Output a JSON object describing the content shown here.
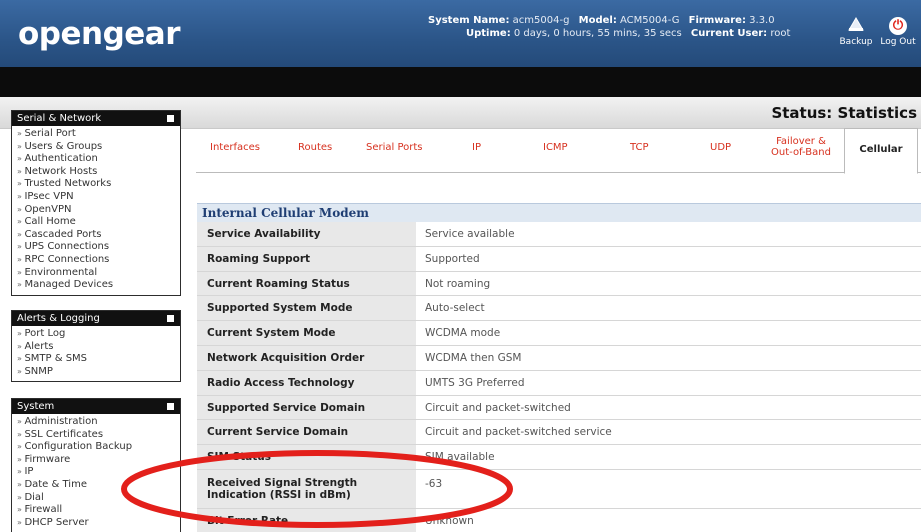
{
  "header": {
    "logo": "opengear",
    "system_name_label": "System Name:",
    "system_name": "acm5004-g",
    "model_label": "Model:",
    "model": "ACM5004-G",
    "firmware_label": "Firmware:",
    "firmware": "3.3.0",
    "uptime_label": "Uptime:",
    "uptime": "0 days, 0 hours, 55 mins, 35 secs",
    "current_user_label": "Current User:",
    "current_user": "root",
    "backup_label": "Backup",
    "logout_label": "Log Out",
    "logout_icon": "power-icon",
    "backup_icon": "backup-icon"
  },
  "page_title": "Status: Statistics",
  "sidebar": {
    "serial_network": {
      "title": "Serial & Network",
      "items": [
        "Serial Port",
        "Users & Groups",
        "Authentication",
        "Network Hosts",
        "Trusted Networks",
        "IPsec VPN",
        "OpenVPN",
        "Call Home",
        "Cascaded Ports",
        "UPS Connections",
        "RPC Connections",
        "Environmental",
        "Managed Devices"
      ]
    },
    "alerts_logging": {
      "title": "Alerts & Logging",
      "items": [
        "Port Log",
        "Alerts",
        "SMTP & SMS",
        "SNMP"
      ]
    },
    "system": {
      "title": "System",
      "items": [
        "Administration",
        "SSL Certificates",
        "Configuration Backup",
        "Firmware",
        "IP",
        "Date & Time",
        "Dial",
        "Firewall",
        "DHCP Server"
      ]
    }
  },
  "tabs": [
    "Interfaces",
    "Routes",
    "Serial Ports",
    "IP",
    "ICMP",
    "TCP",
    "UDP",
    "Failover & Out-of-Band",
    "Cellular"
  ],
  "active_tab": "Cellular",
  "section_title": "Internal Cellular Modem",
  "rows": [
    {
      "key": "Service Availability",
      "value": "Service available"
    },
    {
      "key": "Roaming Support",
      "value": "Supported"
    },
    {
      "key": "Current Roaming Status",
      "value": "Not roaming"
    },
    {
      "key": "Supported System Mode",
      "value": "Auto-select"
    },
    {
      "key": "Current System Mode",
      "value": "WCDMA mode"
    },
    {
      "key": "Network Acquisition Order",
      "value": "WCDMA then GSM"
    },
    {
      "key": "Radio Access Technology",
      "value": "UMTS 3G Preferred"
    },
    {
      "key": "Supported Service Domain",
      "value": "Circuit and packet-switched"
    },
    {
      "key": "Current Service Domain",
      "value": "Circuit and packet-switched service"
    },
    {
      "key": "SIM Status",
      "value": "SIM available"
    },
    {
      "key": "Received Signal Strength Indication (RSSI in dBm)",
      "value": "-63"
    },
    {
      "key": "Bit Error Rate",
      "value": "Unknown"
    }
  ],
  "colors": {
    "header_blue": "#2b5588",
    "tab_red": "#d7311f",
    "annotation_red": "#e3201b"
  }
}
